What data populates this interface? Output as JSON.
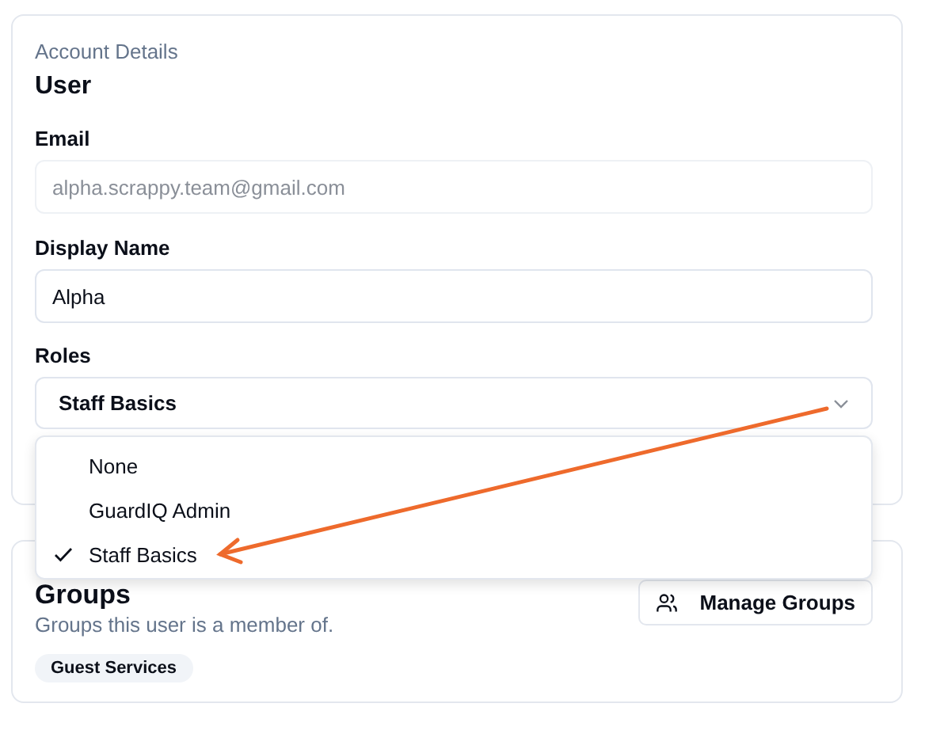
{
  "account": {
    "eyebrow": "Account Details",
    "title": "User",
    "email": {
      "label": "Email",
      "value": "alpha.scrappy.team@gmail.com",
      "disabled": true
    },
    "display_name": {
      "label": "Display Name",
      "value": "Alpha"
    },
    "roles": {
      "label": "Roles",
      "value": "Staff Basics",
      "expanded": true,
      "options": [
        {
          "label": "None",
          "selected": false
        },
        {
          "label": "GuardIQ Admin",
          "selected": false
        },
        {
          "label": "Staff Basics",
          "selected": true
        }
      ]
    }
  },
  "groups": {
    "title": "Groups",
    "subtitle": "Groups this user is a member of.",
    "button": "Manage Groups",
    "tags": [
      "Guest Services"
    ]
  },
  "annotation": {
    "kind": "arrow",
    "color": "#ee6a2c"
  }
}
